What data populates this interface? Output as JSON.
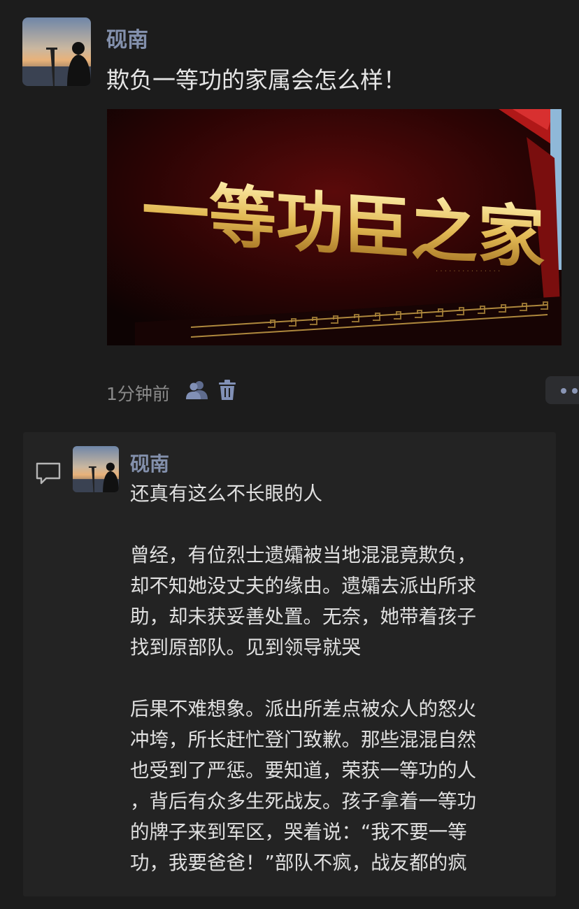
{
  "post": {
    "author": "砚南",
    "text": "欺负一等功的家属会怎么样！",
    "image": {
      "main_text": "一等功臣之家",
      "colors": {
        "panel": "#3a0606",
        "gold": "#e9c86a",
        "frame": "#8a1010"
      }
    },
    "timestamp": "1分钟前",
    "icons": [
      "friends-icon",
      "delete-icon",
      "more-icon"
    ]
  },
  "comment": {
    "author": "砚南",
    "lines": [
      "还真有这么不长眼的人",
      "",
      "曾经，有位烈士遗孀被当地混混竟欺负，",
      "却不知她没丈夫的缘由。遗孀去派出所求",
      "助，却未获妥善处置。无奈，她带着孩子",
      "找到原部队。见到领导就哭",
      "",
      "后果不难想象。派出所差点被众人的怒火",
      "冲垮，所长赶忙登门致歉。那些混混自然",
      "也受到了严惩。要知道，荣获一等功的人",
      "，背后有众多生死战友。孩子拿着一等功",
      "的牌子来到军区，哭着说：“我不要一等",
      "功，我要爸爸！”部队不疯，战友都的疯"
    ]
  },
  "colors": {
    "background": "#1c1c1c",
    "name": "#8390ac",
    "panel": "#232323"
  }
}
